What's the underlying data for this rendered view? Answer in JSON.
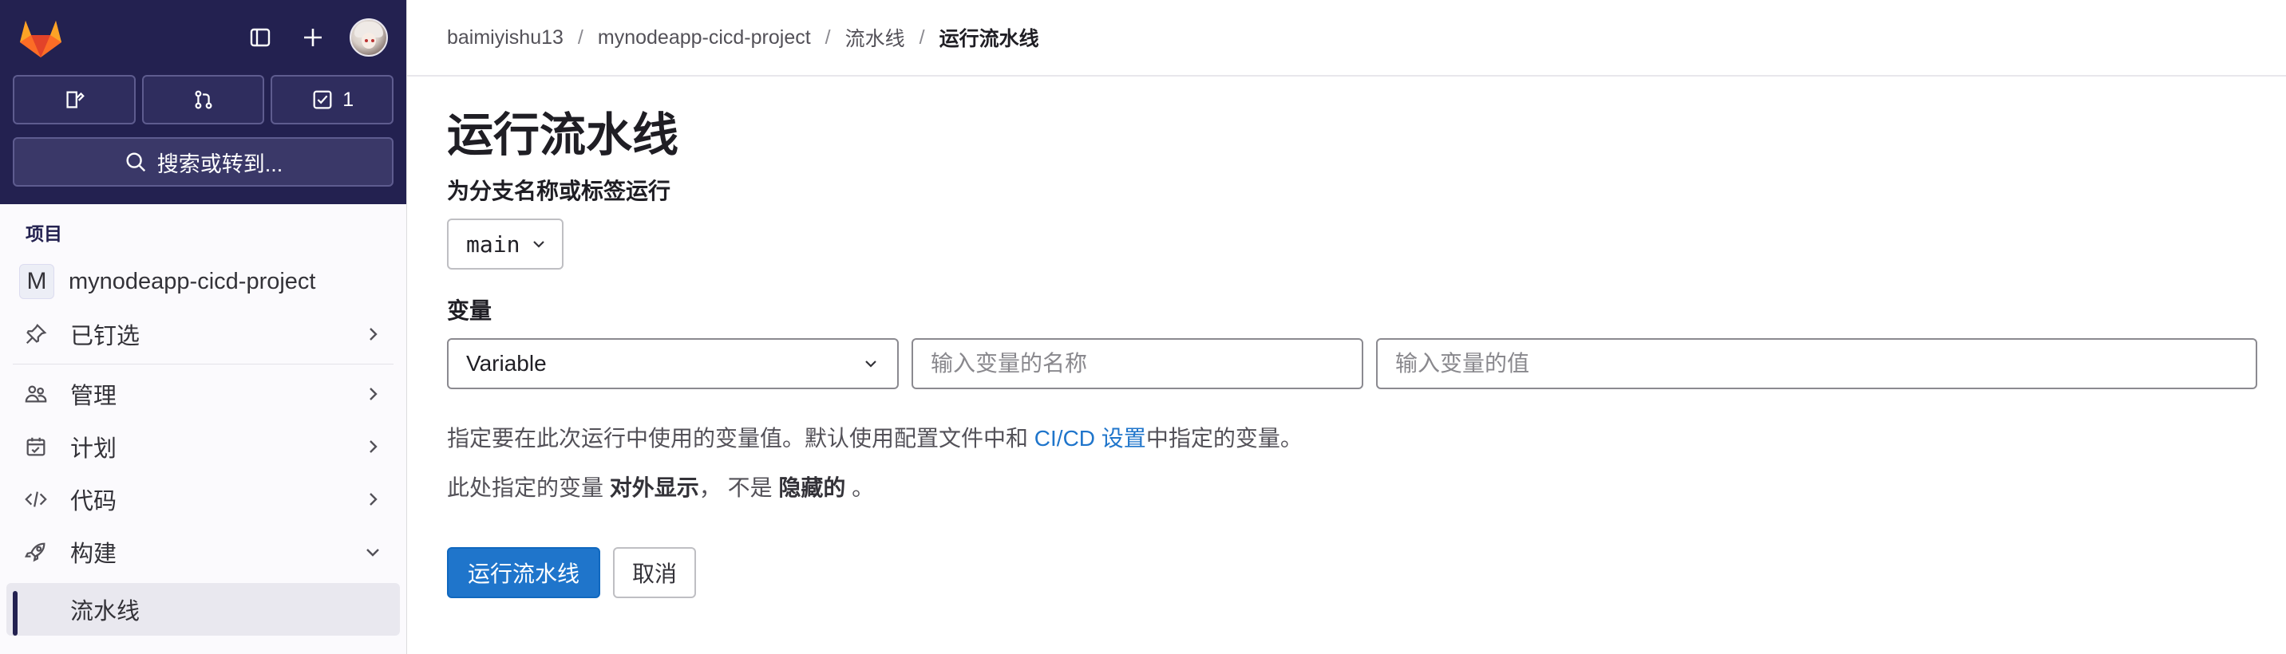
{
  "sidebar": {
    "search_label": "搜索或转到...",
    "todo_count": "1",
    "section_label": "项目",
    "project": {
      "initial": "M",
      "name": "mynodeapp-cicd-project"
    },
    "items": [
      {
        "label": "已钉选"
      },
      {
        "label": "管理"
      },
      {
        "label": "计划"
      },
      {
        "label": "代码"
      },
      {
        "label": "构建"
      }
    ],
    "sub_items": [
      {
        "label": "流水线"
      }
    ]
  },
  "breadcrumb": [
    "baimiyishu13",
    "mynodeapp-cicd-project",
    "流水线",
    "运行流水线"
  ],
  "page": {
    "title": "运行流水线",
    "branch_label": "为分支名称或标签运行",
    "branch_value": "main",
    "variables_label": "变量",
    "var_type": "Variable",
    "var_key_placeholder": "输入变量的名称",
    "var_value_placeholder": "输入变量的值",
    "help_prefix": "指定要在此次运行中使用的变量值。默认使用配置文件中和 ",
    "help_link": "CI/CD 设置",
    "help_suffix": "中指定的变量。",
    "help2_prefix": "此处指定的变量 ",
    "help2_bold1": "对外显示",
    "help2_mid": "， 不是 ",
    "help2_bold2": "隐藏的",
    "help2_end": " 。",
    "run_button": "运行流水线",
    "cancel_button": "取消"
  },
  "colors": {
    "sidebar_top": "#232150",
    "primary": "#1f75cb",
    "link": "#1f75cb"
  }
}
